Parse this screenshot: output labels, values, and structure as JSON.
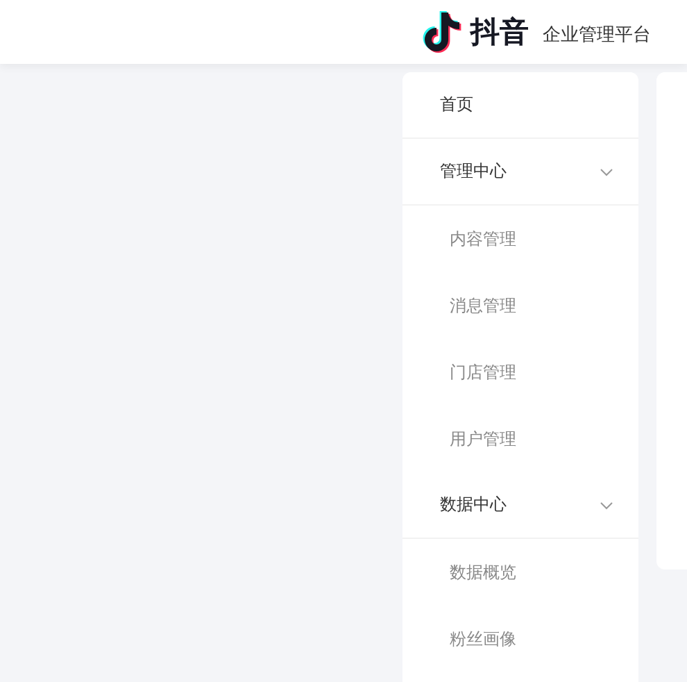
{
  "header": {
    "brand": "抖音",
    "subtitle": "企业管理平台"
  },
  "menu": [
    {
      "kind": "item",
      "label": "首页"
    },
    {
      "kind": "group",
      "label": "管理中心",
      "expanded": true,
      "children": [
        {
          "label": "内容管理"
        },
        {
          "label": "消息管理"
        },
        {
          "label": "门店管理"
        },
        {
          "label": "用户管理"
        }
      ]
    },
    {
      "kind": "group",
      "label": "数据中心",
      "expanded": true,
      "children": [
        {
          "label": "数据概览"
        },
        {
          "label": "粉丝画像"
        }
      ]
    }
  ]
}
